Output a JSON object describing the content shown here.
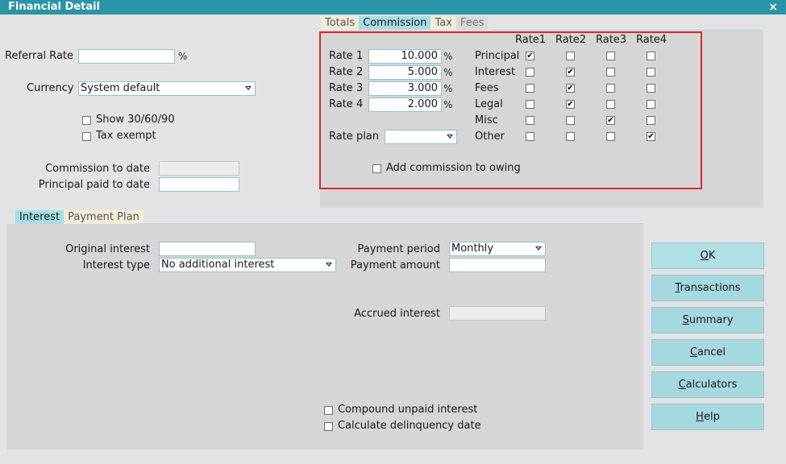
{
  "window": {
    "title": "Financial Detail",
    "close_glyph": "×"
  },
  "left": {
    "referral_rate_label": "Referral Rate",
    "referral_rate_value": "",
    "referral_rate_unit": "%",
    "currency_label": "Currency",
    "currency_value": "System default",
    "show_30_60_90_label": "Show 30/60/90",
    "show_30_60_90_checked": false,
    "tax_exempt_label": "Tax exempt",
    "tax_exempt_checked": false,
    "commission_to_date_label": "Commission to date",
    "commission_to_date_value": "",
    "principal_paid_label": "Principal paid to date",
    "principal_paid_value": ""
  },
  "top_tabs": [
    {
      "label": "Totals",
      "state": "inactive"
    },
    {
      "label": "Commission",
      "state": "active"
    },
    {
      "label": "Tax",
      "state": "inactive"
    },
    {
      "label": "Fees",
      "state": "disabled"
    }
  ],
  "commission": {
    "rate_columns": [
      "Rate1",
      "Rate2",
      "Rate3",
      "Rate4"
    ],
    "rates": [
      {
        "label": "Rate 1",
        "value": "10.000",
        "unit": "%"
      },
      {
        "label": "Rate 2",
        "value": "5.000",
        "unit": "%"
      },
      {
        "label": "Rate 3",
        "value": "3.000",
        "unit": "%"
      },
      {
        "label": "Rate 4",
        "value": "2.000",
        "unit": "%"
      }
    ],
    "categories": [
      {
        "label": "Principal",
        "checks": [
          true,
          false,
          false,
          false
        ]
      },
      {
        "label": "Interest",
        "checks": [
          false,
          true,
          false,
          false
        ]
      },
      {
        "label": "Fees",
        "checks": [
          false,
          true,
          false,
          false
        ]
      },
      {
        "label": "Legal",
        "checks": [
          false,
          true,
          false,
          false
        ]
      },
      {
        "label": "Misc",
        "checks": [
          false,
          false,
          true,
          false
        ]
      },
      {
        "label": "Other",
        "checks": [
          false,
          false,
          false,
          true
        ]
      }
    ],
    "rate_plan_label": "Rate plan",
    "rate_plan_value": "",
    "add_commission_label": "Add commission to owing",
    "add_commission_checked": false
  },
  "bottom_tabs": [
    {
      "label": "Interest",
      "state": "active"
    },
    {
      "label": "Payment Plan",
      "state": "inactive"
    }
  ],
  "interest": {
    "original_interest_label": "Original interest",
    "original_interest_value": "",
    "interest_type_label": "Interest type",
    "interest_type_value": "No additional interest",
    "payment_period_label": "Payment period",
    "payment_period_value": "Monthly",
    "payment_amount_label": "Payment amount",
    "payment_amount_value": "",
    "accrued_interest_label": "Accrued interest",
    "accrued_interest_value": "",
    "compound_label": "Compound unpaid interest",
    "compound_checked": false,
    "delinquency_label": "Calculate delinquency date",
    "delinquency_checked": false
  },
  "buttons": [
    {
      "name": "ok-button",
      "mnemonic": "O",
      "rest": "K"
    },
    {
      "name": "transactions-button",
      "mnemonic": "T",
      "rest": "ransactions"
    },
    {
      "name": "summary-button",
      "mnemonic": "S",
      "rest": "ummary"
    },
    {
      "name": "cancel-button",
      "mnemonic": "C",
      "rest": "ancel"
    },
    {
      "name": "calculators-button",
      "mnemonic": "C",
      "rest": "alculators"
    },
    {
      "name": "help-button",
      "mnemonic": "H",
      "rest": "elp"
    }
  ],
  "colors": {
    "title_bar": "#2a95a6",
    "active_tab": "#a9dde5",
    "highlight_frame": "#e0282e",
    "button": "#a6d8df"
  }
}
